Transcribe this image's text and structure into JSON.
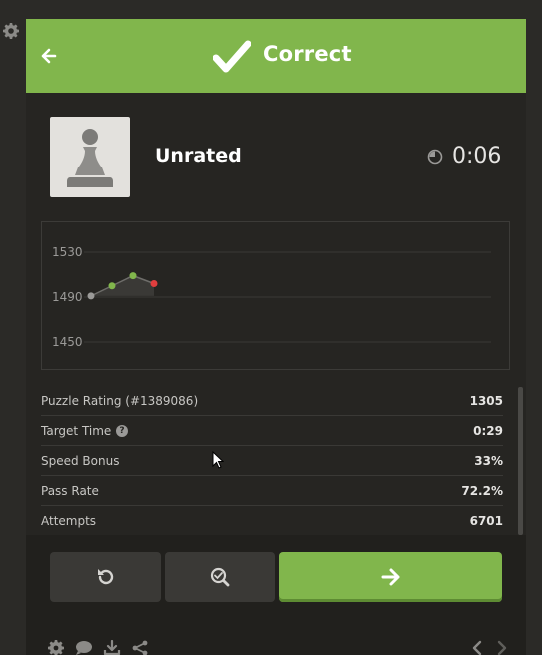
{
  "header": {
    "title": "Correct"
  },
  "puzzle": {
    "rating_label": "Unrated",
    "clock": "0:06"
  },
  "chart_data": {
    "type": "line",
    "y_ticks": [
      "1530",
      "1490",
      "1450"
    ],
    "ylim": [
      1450,
      1530
    ],
    "points": [
      {
        "x": 0,
        "y": 1491,
        "status": "start"
      },
      {
        "x": 1,
        "y": 1500,
        "status": "correct"
      },
      {
        "x": 2,
        "y": 1509,
        "status": "correct"
      },
      {
        "x": 3,
        "y": 1502,
        "status": "incorrect"
      }
    ]
  },
  "stats": [
    {
      "label": "Puzzle Rating (#1389086)",
      "value": "1305",
      "help": false
    },
    {
      "label": "Target Time",
      "value": "0:29",
      "help": true
    },
    {
      "label": "Speed Bonus",
      "value": "33%",
      "help": false
    },
    {
      "label": "Pass Rate",
      "value": "72.2%",
      "help": false
    },
    {
      "label": "Attempts",
      "value": "6701",
      "help": false
    }
  ],
  "help_glyph": "?",
  "colors": {
    "accent_green": "#81b64c",
    "incorrect_red": "#e03e3e",
    "panel_bg": "#262522"
  },
  "icons": {
    "left": "gear-icon",
    "header_back": "arrow-left-icon",
    "header_status": "checkmark-icon",
    "clock": "timer-icon",
    "buttons": [
      "retry-icon",
      "analyze-icon",
      "arrow-right-icon"
    ],
    "footer": [
      "gear-icon",
      "chat-icon",
      "download-icon",
      "share-icon",
      "chevron-left-icon",
      "chevron-right-icon"
    ]
  }
}
